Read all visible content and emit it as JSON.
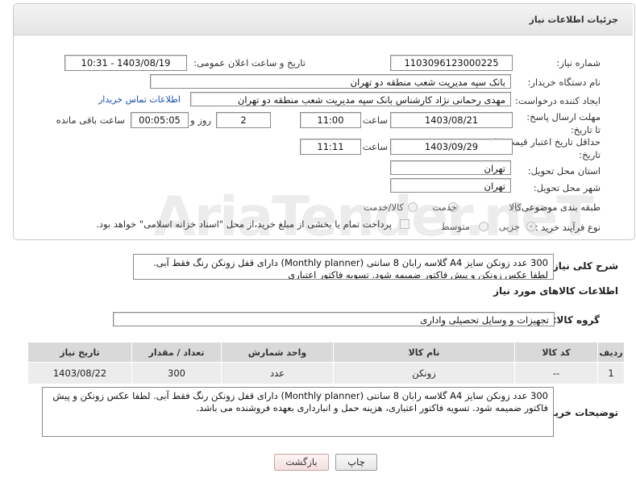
{
  "header": {
    "title": "جزئیات اطلاعات نیاز"
  },
  "form": {
    "need_number": {
      "label": "شماره نیاز:",
      "value": "1103096123000225"
    },
    "announce": {
      "label": "تاریخ و ساعت اعلان عمومی:",
      "value": "1403/08/19 - 10:31"
    },
    "buyer_org": {
      "label": "نام دستگاه خریدار:",
      "value": "بانک سپه مدیریت شعب منطقه دو تهران"
    },
    "requester": {
      "label": "ایجاد کننده درخواست:",
      "value": "مهدی رحمانی نژاد کارشناس بانک سپه مدیریت شعب منطقه دو تهران",
      "contact_link": "اطلاعات تماس خریدار"
    },
    "reply_deadline": {
      "label": "مهلت ارسال پاسخ: تا تاریخ:",
      "date": "1403/08/21",
      "time_label": "ساعت",
      "time": "11:00",
      "days": "2",
      "days_label": "روز و",
      "remaining": "00:05:05",
      "remaining_label": "ساعت باقی مانده"
    },
    "price_validity": {
      "label": "حداقل تاریخ اعتبار قیمت: تا تاریخ:",
      "date": "1403/09/29",
      "time_label": "ساعت",
      "time": "11:11"
    },
    "province": {
      "label": "استان محل تحویل:",
      "value": "تهران"
    },
    "city": {
      "label": "شهر محل تحویل:",
      "value": "تهران"
    },
    "category": {
      "label": "طبقه بندی موضوعی:",
      "options": [
        "کالا",
        "خدمت",
        "کالا/خدمت"
      ],
      "selected": "کالا"
    },
    "purchase_type": {
      "label": "نوع فرآیند خرید :",
      "options": [
        "جزیی",
        "متوسط"
      ],
      "selected": "جزیی",
      "treasury_note": "پرداخت تمام یا بخشی از مبلغ خرید،از محل \"اسناد خزانه اسلامی\" خواهد بود."
    }
  },
  "description": {
    "label": "شرح کلی نیاز:",
    "text": "300 عدد زونکن سایز A4 گلاسه رابان 8 سانتی (Monthly planner) دارای قفل زونکن رنگ فقط آبی. لطفا عکس زونکن و پیش فاکتور ضمیمه شود. تسویه فاکتور  اعتباری"
  },
  "goods": {
    "section_title": "اطلاعات کالاهای مورد نیاز",
    "group_label": "گروه کالا:",
    "group_value": "تجهیزات و وسایل تحصیلی واداری",
    "columns": [
      "ردیف",
      "کد کالا",
      "نام کالا",
      "واحد شمارش",
      "تعداد / مقدار",
      "تاریخ نیاز"
    ],
    "rows": [
      {
        "row": "1",
        "code": "--",
        "name": "زونکن",
        "unit": "عدد",
        "qty": "300",
        "date": "1403/08/22"
      }
    ]
  },
  "buyer_notes": {
    "label": "توضیحات خریدار:",
    "text": "300 عدد زونکن سایز A4 گلاسه رابان 8 سانتی (Monthly planner) دارای قفل زونکن رنگ فقط آبی. لطفا عکس زونکن و پیش فاکتور ضمیمه شود. تسویه فاکتور  اعتباری، هزینه حمل و انبارداری بعهده فروشنده می باشد."
  },
  "buttons": {
    "print": "چاپ",
    "back": "بازگشت"
  },
  "watermark": "AriaTender.neT",
  "colors": {
    "link": "#1a4fb0",
    "header_bg": "#e4e4e4",
    "table_head": "#d9d9d9"
  }
}
